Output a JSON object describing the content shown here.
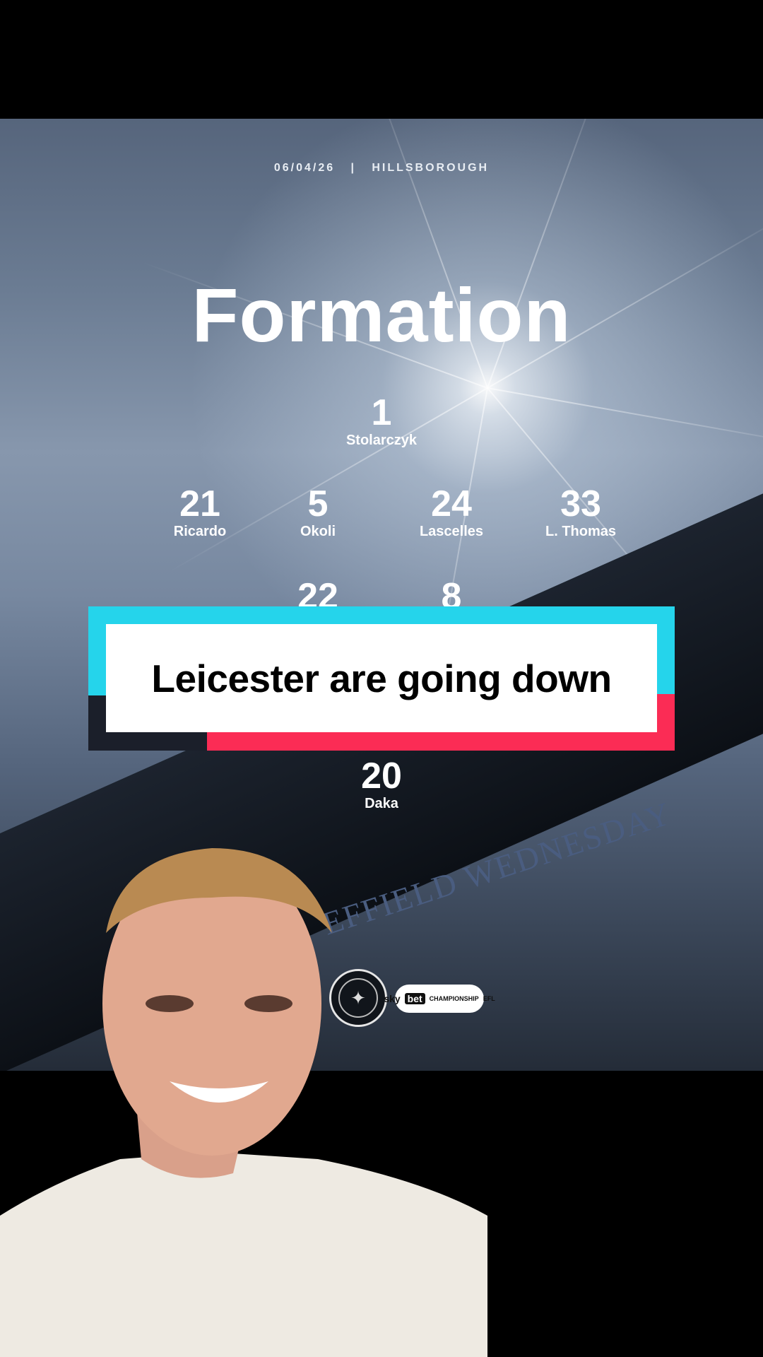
{
  "graphic": {
    "date": "06/04/26",
    "separator": "|",
    "venue": "HILLSBOROUGH",
    "title": "Formation",
    "stand_text": "EFFIELD WEDNESDAY",
    "players": [
      {
        "number": "1",
        "name": "Stolarczyk"
      },
      {
        "number": "21",
        "name": "Ricardo"
      },
      {
        "number": "5",
        "name": "Okoli"
      },
      {
        "number": "24",
        "name": "Lascelles"
      },
      {
        "number": "33",
        "name": "L. Thomas"
      },
      {
        "number": "22",
        "name": ""
      },
      {
        "number": "8",
        "name": ""
      },
      {
        "number": "20",
        "name": "Daka"
      }
    ],
    "sponsor": {
      "sky": "sky",
      "bet": "bet",
      "league": "CHAMPIONSHIP",
      "efl": "EFL"
    }
  },
  "caption": "Leicester are going down",
  "colors": {
    "caption_cyan": "#25d4eb",
    "caption_red": "#fb2c55",
    "caption_dark": "#1b1f2a"
  }
}
